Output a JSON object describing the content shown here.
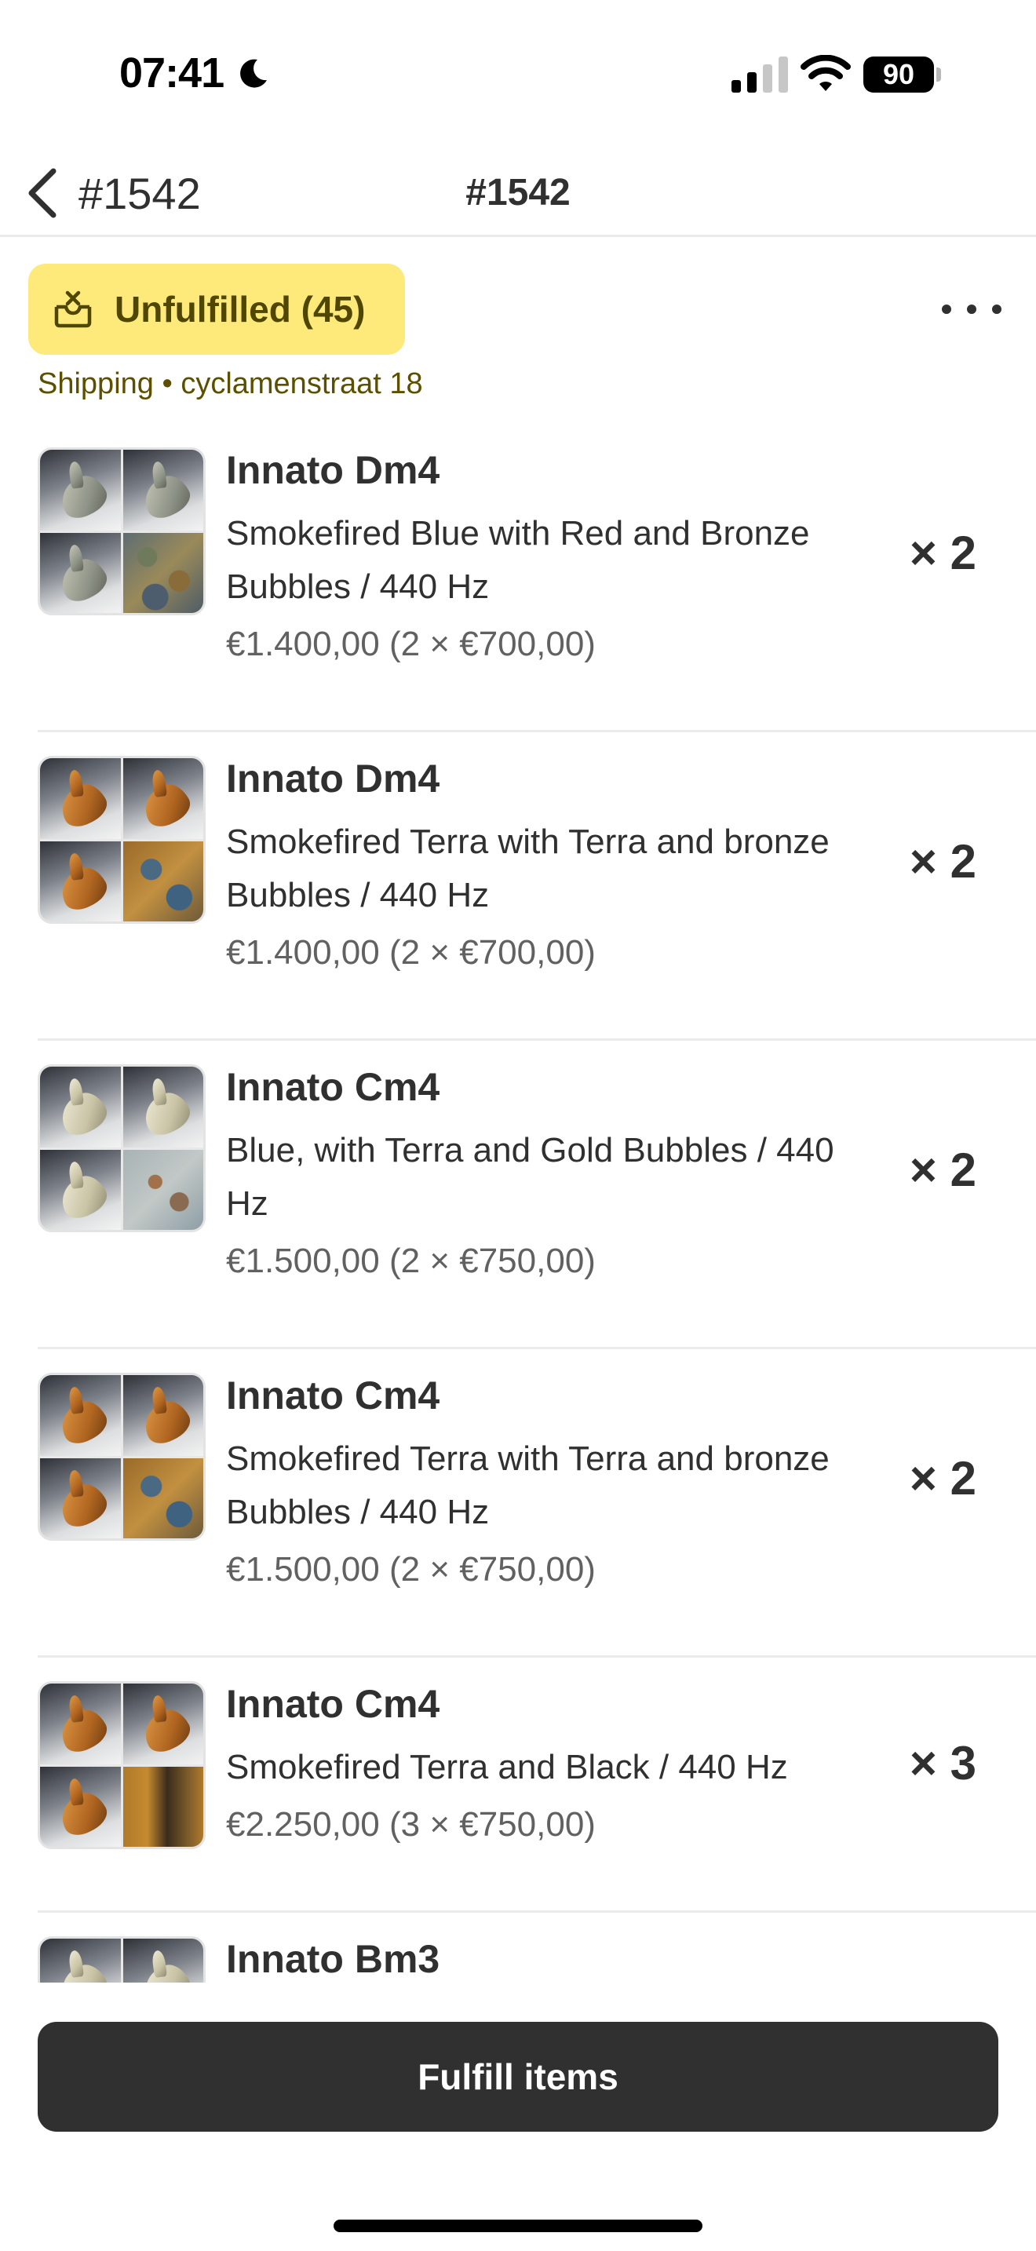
{
  "status_bar": {
    "time": "07:41",
    "battery": "90"
  },
  "nav": {
    "back_label": "#1542",
    "title": "#1542"
  },
  "fulfillment": {
    "status_label": "Unfulfilled (45)",
    "status_color": "#fdea7b",
    "shipping": "Shipping • cyclamenstraat 18"
  },
  "line_items": [
    {
      "title": "Innato Dm4",
      "variant": "Smokefired Blue with Red and Bronze Bubbles / 440 Hz",
      "price": "€1.400,00 (2 × €700,00)",
      "quantity": "× 2",
      "thumb_style": "blue"
    },
    {
      "title": "Innato Dm4",
      "variant": "Smokefired Terra with Terra and bronze Bubbles / 440 Hz",
      "price": "€1.400,00 (2 × €700,00)",
      "quantity": "× 2",
      "thumb_style": "terra"
    },
    {
      "title": "Innato Cm4",
      "variant": "Blue, with Terra and Gold Bubbles / 440 Hz",
      "price": "€1.500,00 (2 × €750,00)",
      "quantity": "× 2",
      "thumb_style": "light"
    },
    {
      "title": "Innato Cm4",
      "variant": "Smokefired Terra with Terra and bronze Bubbles / 440 Hz",
      "price": "€1.500,00 (2 × €750,00)",
      "quantity": "× 2",
      "thumb_style": "terra"
    },
    {
      "title": "Innato Cm4",
      "variant": "Smokefired Terra and Black / 440 Hz",
      "price": "€2.250,00 (3 × €750,00)",
      "quantity": "× 3",
      "thumb_style": "black"
    },
    {
      "title": "Innato Bm3",
      "variant": "",
      "price": "",
      "quantity": "",
      "thumb_style": "light"
    }
  ],
  "footer": {
    "primary_action": "Fulfill items"
  }
}
